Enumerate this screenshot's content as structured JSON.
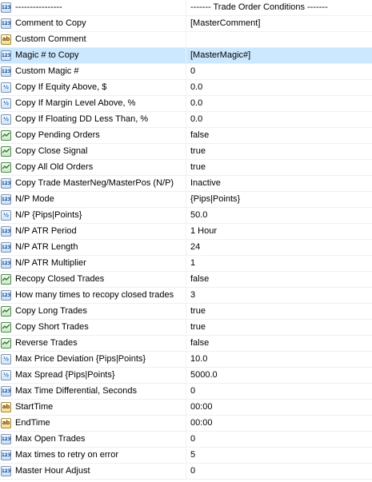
{
  "rows": [
    {
      "name": "----------------",
      "value": "------- Trade Order Conditions -------",
      "type": "int"
    },
    {
      "name": "Comment to Copy",
      "value": "[MasterComment]",
      "type": "int"
    },
    {
      "name": "Custom Comment",
      "value": "",
      "type": "string"
    },
    {
      "name": "Magic # to Copy",
      "value": "[MasterMagic#]",
      "type": "int",
      "selected": true
    },
    {
      "name": "Custom Magic #",
      "value": "0",
      "type": "int"
    },
    {
      "name": "Copy If Equity Above, $",
      "value": "0.0",
      "type": "double"
    },
    {
      "name": "Copy If Margin Level Above, %",
      "value": "0.0",
      "type": "double"
    },
    {
      "name": "Copy If Floating DD Less Than, %",
      "value": "0.0",
      "type": "double"
    },
    {
      "name": "Copy Pending Orders",
      "value": "false",
      "type": "bool"
    },
    {
      "name": "Copy Close Signal",
      "value": "true",
      "type": "bool"
    },
    {
      "name": "Copy All Old Orders",
      "value": "true",
      "type": "bool"
    },
    {
      "name": "Copy Trade MasterNeg/MasterPos (N/P)",
      "value": "Inactive",
      "type": "int"
    },
    {
      "name": "N/P Mode",
      "value": "{Pips|Points}",
      "type": "int"
    },
    {
      "name": "N/P {Pips|Points}",
      "value": "50.0",
      "type": "double"
    },
    {
      "name": "N/P ATR Period",
      "value": "1 Hour",
      "type": "int"
    },
    {
      "name": "N/P ATR Length",
      "value": "24",
      "type": "int"
    },
    {
      "name": "N/P ATR Multiplier",
      "value": "1",
      "type": "int"
    },
    {
      "name": "Recopy Closed Trades",
      "value": "false",
      "type": "bool"
    },
    {
      "name": "How many times to recopy closed trades",
      "value": "3",
      "type": "int"
    },
    {
      "name": "Copy Long Trades",
      "value": "true",
      "type": "bool"
    },
    {
      "name": "Copy Short Trades",
      "value": "true",
      "type": "bool"
    },
    {
      "name": "Reverse Trades",
      "value": "false",
      "type": "bool"
    },
    {
      "name": "Max Price Deviation {Pips|Points}",
      "value": "10.0",
      "type": "double"
    },
    {
      "name": "Max Spread {Pips|Points}",
      "value": "5000.0",
      "type": "double"
    },
    {
      "name": "Max Time Differential, Seconds",
      "value": "0",
      "type": "int"
    },
    {
      "name": "StartTime",
      "value": "00:00",
      "type": "string"
    },
    {
      "name": "EndTime",
      "value": "00:00",
      "type": "string"
    },
    {
      "name": "Max Open Trades",
      "value": "0",
      "type": "int"
    },
    {
      "name": "Max times to retry on error",
      "value": "5",
      "type": "int"
    },
    {
      "name": "Master Hour Adjust",
      "value": "0",
      "type": "int"
    }
  ],
  "type_icons": {
    "int": {
      "icon": "integer-type-icon",
      "glyph": "123"
    },
    "double": {
      "icon": "double-type-icon",
      "glyph": "½"
    },
    "string": {
      "icon": "string-type-icon",
      "glyph": "ab"
    },
    "bool": {
      "icon": "boolean-type-icon",
      "glyph": ""
    }
  },
  "colors": {
    "selected_row": "#cce8ff",
    "grid_line": "#f0f0f0"
  }
}
